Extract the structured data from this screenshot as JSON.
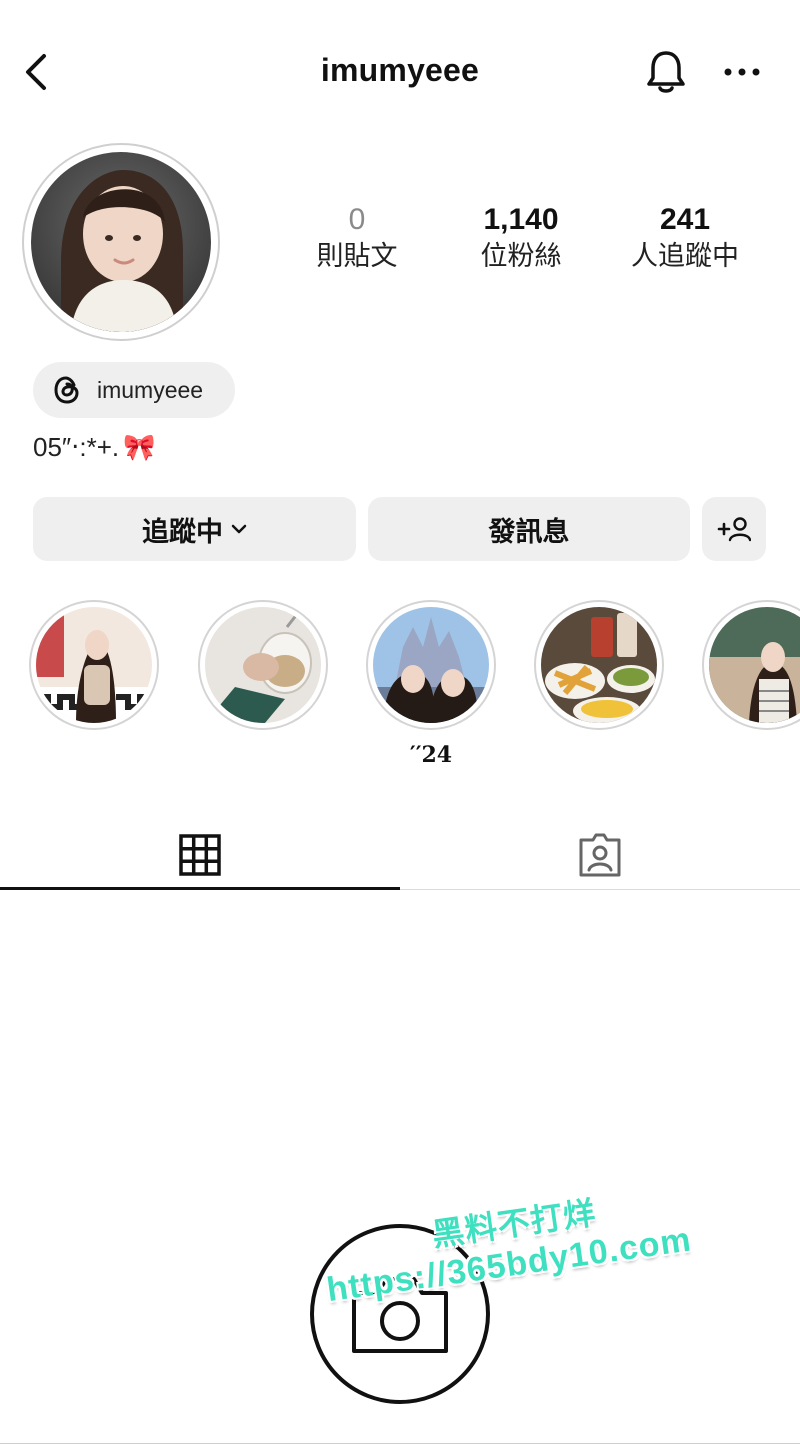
{
  "header": {
    "username": "imumyeee",
    "back_icon": "chevron-left-icon",
    "notification_icon": "bell-icon",
    "more_icon": "more-horizontal-icon"
  },
  "profile": {
    "stats": [
      {
        "value": "0",
        "label": "則貼文"
      },
      {
        "value": "1,140",
        "label": "位粉絲"
      },
      {
        "value": "241",
        "label": "人追蹤中"
      }
    ],
    "threads_handle": "imumyeee",
    "bio_text": "05″‧:*+.",
    "bio_emoji": "🎀"
  },
  "actions": {
    "following_label": "追蹤中",
    "message_label": "發訊息"
  },
  "highlights": [
    {
      "label": ""
    },
    {
      "label": ""
    },
    {
      "label": "′′24"
    },
    {
      "label": ""
    },
    {
      "label": ""
    }
  ],
  "tabs": [
    {
      "icon": "grid-icon",
      "active": true
    },
    {
      "icon": "tagged-person-icon",
      "active": false
    }
  ],
  "watermark": {
    "line1": "黑料不打烊",
    "line2": "https://365bdy10.com"
  },
  "colors": {
    "button_bg": "#efefef",
    "watermark": "#3fe0c0"
  }
}
